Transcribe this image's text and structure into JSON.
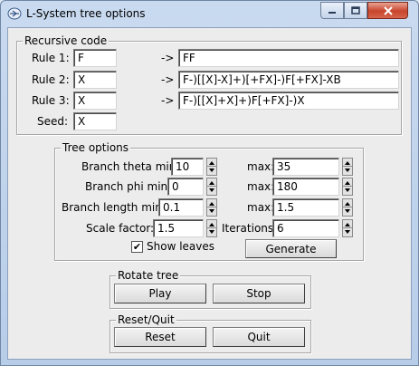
{
  "window": {
    "title": "L-System tree options",
    "caption_min": "−",
    "caption_max": "□",
    "caption_close": "✕"
  },
  "recursive": {
    "group_label": "Recursive code",
    "arrow": "->",
    "rules": [
      {
        "label": "Rule 1:",
        "symbol": "F",
        "replacement": "FF"
      },
      {
        "label": "Rule 2:",
        "symbol": "X",
        "replacement": "F-)[[X]-X]+)[+FX]-)F[+FX]-XB"
      },
      {
        "label": "Rule 3:",
        "symbol": "X",
        "replacement": "F-)[[X]+X]+)F[+FX]-)X"
      }
    ],
    "seed_label": "Seed:",
    "seed_value": "X"
  },
  "tree": {
    "group_label": "Tree options",
    "theta_min_label": "Branch theta min:",
    "theta_min": "10",
    "theta_max_label": "max:",
    "theta_max": "35",
    "phi_min_label": "Branch phi min:",
    "phi_min": "0",
    "phi_max_label": "max:",
    "phi_max": "180",
    "length_min_label": "Branch length min:",
    "length_min": "0.1",
    "length_max_label": "max:",
    "length_max": "1.5",
    "scale_label": "Scale factor:",
    "scale": "1.5",
    "iterations_label": "Iterations:",
    "iterations": "6",
    "show_leaves_label": "Show leaves",
    "show_leaves_checked": true,
    "check_mark": "✔",
    "generate_label": "Generate"
  },
  "rotate": {
    "group_label": "Rotate tree",
    "play_label": "Play",
    "stop_label": "Stop"
  },
  "resetquit": {
    "group_label": "Reset/Quit",
    "reset_label": "Reset",
    "quit_label": "Quit"
  }
}
